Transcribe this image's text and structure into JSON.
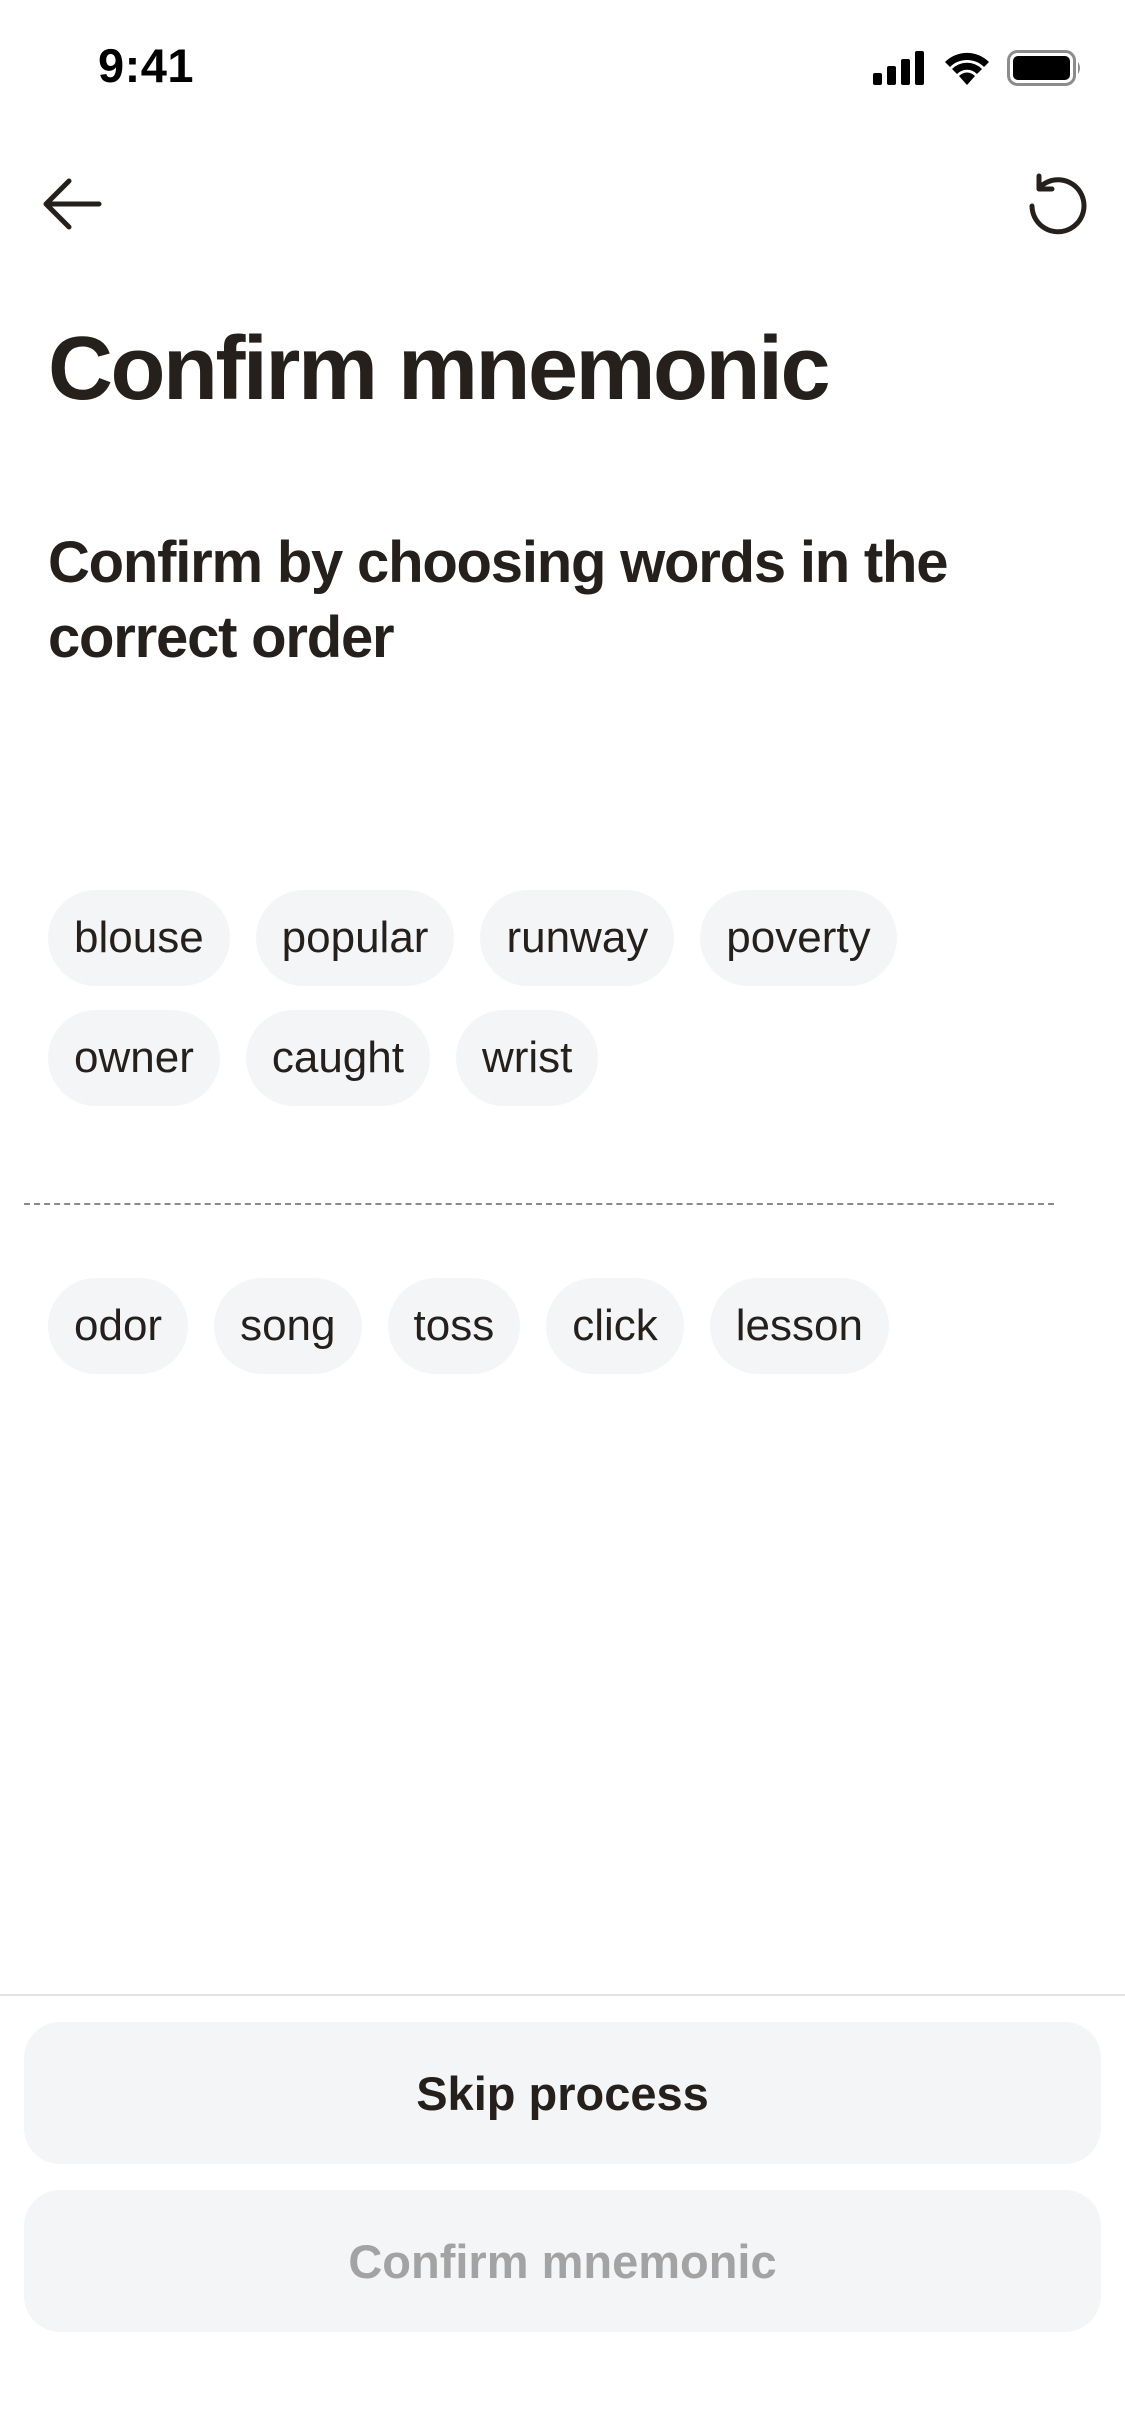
{
  "status_bar": {
    "time": "9:41",
    "icons": [
      "cellular-signal-icon",
      "wifi-icon",
      "battery-icon"
    ]
  },
  "nav": {
    "back_icon": "arrow-left-icon",
    "reset_icon": "refresh-icon"
  },
  "page": {
    "title": "Confirm mnemonic",
    "subtitle": "Confirm by choosing words in the correct order"
  },
  "selected_words": [
    "blouse",
    "popular",
    "runway",
    "poverty",
    "owner",
    "caught",
    "wrist"
  ],
  "available_words": [
    "odor",
    "song",
    "toss",
    "click",
    "lesson"
  ],
  "buttons": {
    "skip_label": "Skip process",
    "confirm_label": "Confirm mnemonic"
  },
  "colors": {
    "text": "#25201c",
    "chip_bg": "#f4f5f7",
    "disabled_text": "#a3a3a3"
  }
}
